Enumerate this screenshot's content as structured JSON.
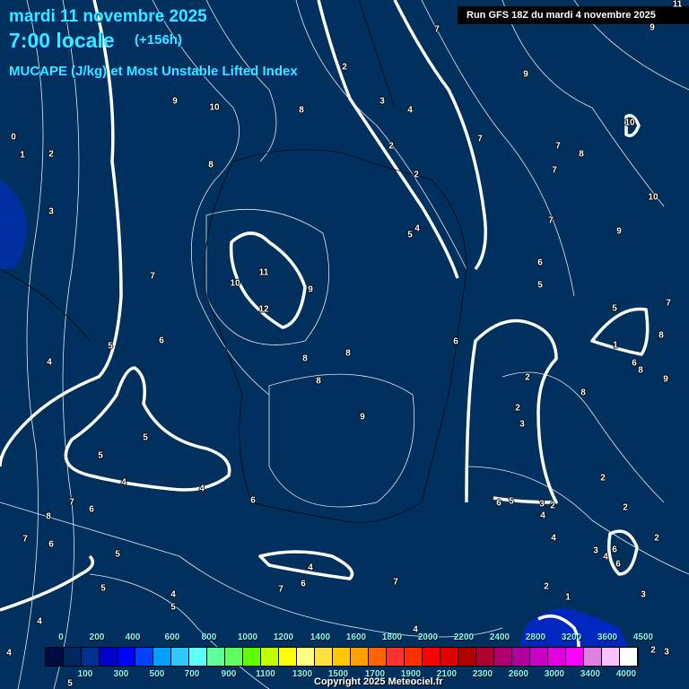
{
  "header": {
    "date": "mardi 11 novembre 2025",
    "time": "7:00 locale",
    "lead": "(+156h)",
    "parameter": "MUCAPE (J/kg) et Most Unstable Lifted Index",
    "run": "Run GFS 18Z du mardi 4 novembre 2025"
  },
  "legend": {
    "top_ticks": [
      "0",
      "200",
      "400",
      "600",
      "800",
      "1000",
      "1200",
      "1400",
      "1600",
      "1800",
      "2000",
      "2200",
      "2400",
      "2800",
      "3200",
      "3600",
      "4500"
    ],
    "bottom_ticks": [
      "100",
      "300",
      "500",
      "700",
      "900",
      "1100",
      "1300",
      "1500",
      "1700",
      "1900",
      "2100",
      "2300",
      "2600",
      "3000",
      "3400",
      "4000"
    ],
    "colors": [
      "#000c40",
      "#002860",
      "#003090",
      "#0000c8",
      "#0000ff",
      "#0040ff",
      "#00a0ff",
      "#30c8ff",
      "#60ffff",
      "#60ff98",
      "#60ff60",
      "#60ff00",
      "#c0ff00",
      "#ffff00",
      "#ffff80",
      "#ffe040",
      "#ffc800",
      "#ffa000",
      "#ff6400",
      "#ff3232",
      "#ff3000",
      "#ff0000",
      "#e00000",
      "#b00000",
      "#b00030",
      "#b00070",
      "#b000a0",
      "#c800c8",
      "#e000e0",
      "#ff00ff",
      "#e080e0",
      "#ffc0ff",
      "#ffffff"
    ]
  },
  "copyright": "Copyright 2025 Meteociel.fr",
  "contour_labels": [
    "0",
    "1",
    "2",
    "3",
    "9",
    "10",
    "8",
    "8",
    "2",
    "3",
    "4",
    "7",
    "2",
    "2",
    "7",
    "9",
    "7",
    "7",
    "8",
    "10",
    "10",
    "9",
    "7",
    "5",
    "4",
    "6",
    "5",
    "11",
    "10",
    "9",
    "12",
    "7",
    "6",
    "5",
    "4",
    "8",
    "8",
    "8",
    "9",
    "6",
    "5",
    "1",
    "8",
    "7",
    "6",
    "8",
    "9",
    "8",
    "2",
    "2",
    "3",
    "5",
    "5",
    "4",
    "4",
    "6",
    "7",
    "6",
    "8",
    "7",
    "6",
    "5",
    "5",
    "4",
    "5",
    "4",
    "4",
    "4",
    "6",
    "7",
    "7",
    "6",
    "5",
    "3",
    "2",
    "4",
    "4",
    "2",
    "2",
    "2",
    "3",
    "4",
    "6",
    "6",
    "2",
    "1",
    "3",
    "4",
    "2",
    "3",
    "5",
    "9",
    "11"
  ]
}
